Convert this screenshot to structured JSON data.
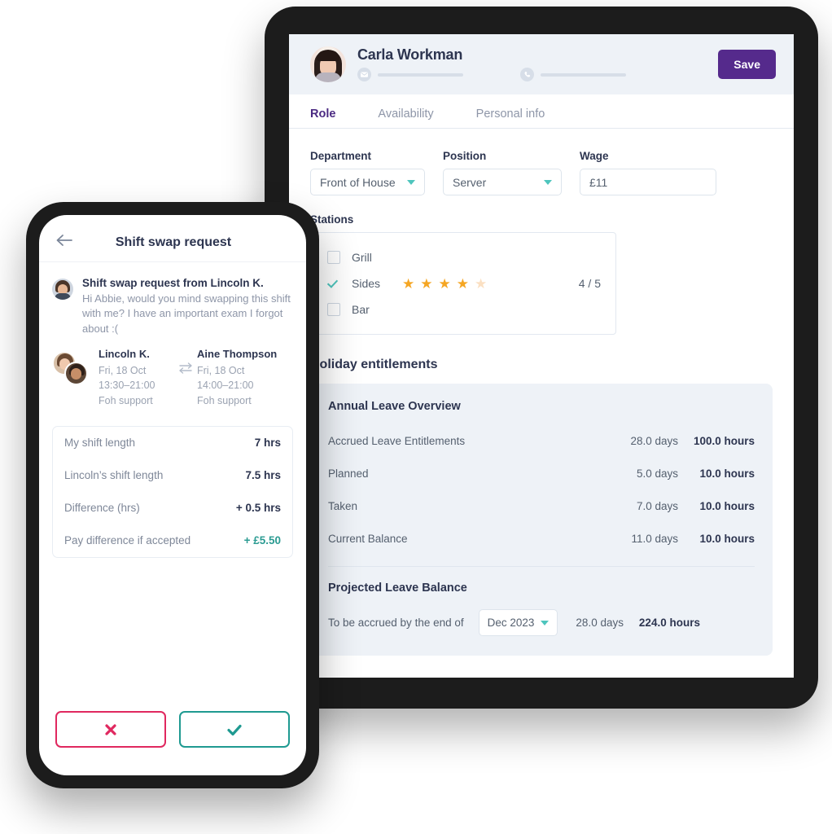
{
  "desktop": {
    "header": {
      "name": "Carla Workman",
      "avatar_icon": "user-avatar",
      "email_icon": "envelope-icon",
      "phone_icon": "phone-icon",
      "save_label": "Save",
      "save_color": "#552a8c",
      "background": "#eef2f7"
    },
    "tabs": [
      {
        "label": "Role",
        "active": true
      },
      {
        "label": "Availability",
        "active": false
      },
      {
        "label": "Personal info",
        "active": false
      }
    ],
    "fields": {
      "department": {
        "label": "Department",
        "value": "Front of House"
      },
      "position": {
        "label": "Position",
        "value": "Server"
      },
      "wage": {
        "label": "Wage",
        "value": "£11"
      }
    },
    "stations": {
      "label": "Stations",
      "items": [
        {
          "name": "Grill",
          "checked": false,
          "rating": null,
          "score": ""
        },
        {
          "name": "Sides",
          "checked": true,
          "rating": 4,
          "max": 5,
          "score": "4 / 5"
        },
        {
          "name": "Bar",
          "checked": false,
          "rating": null,
          "score": ""
        }
      ]
    },
    "holiday": {
      "title": "Holiday entitlements",
      "overview_title": "Annual Leave Overview",
      "rows": [
        {
          "label": "Accrued Leave Entitlements",
          "days": "28.0 days",
          "hours": "100.0 hours"
        },
        {
          "label": "Planned",
          "days": "5.0 days",
          "hours": "10.0 hours"
        },
        {
          "label": "Taken",
          "days": "7.0 days",
          "hours": "10.0 hours"
        },
        {
          "label": "Current Balance",
          "days": "11.0 days",
          "hours": "10.0 hours"
        }
      ],
      "projected_title": "Projected Leave Balance",
      "projected": {
        "label": "To be accrued by the end of",
        "month": "Dec 2023",
        "days": "28.0 days",
        "hours": "224.0 hours"
      }
    }
  },
  "phone": {
    "back_icon": "back-arrow-icon",
    "title": "Shift swap request",
    "message": {
      "title": "Shift swap request from Lincoln K.",
      "body": "Hi Abbie, would you mind swapping this shift with me? I have an important exam I forgot about :("
    },
    "swap": {
      "icon": "swap-arrows-icon",
      "from": {
        "name": "Lincoln K.",
        "date": "Fri, 18 Oct",
        "time": "13:30–21:00",
        "role": "Foh support"
      },
      "to": {
        "name": "Aine Thompson",
        "date": "Fri, 18 Oct",
        "time": "14:00–21:00",
        "role": "Foh support"
      }
    },
    "details": [
      {
        "label": "My shift length",
        "value": "7 hrs",
        "accent": false
      },
      {
        "label": "Lincoln’s shift length",
        "value": "7.5 hrs",
        "accent": false
      },
      {
        "label": "Difference (hrs)",
        "value": "+ 0.5 hrs",
        "accent": false
      },
      {
        "label": "Pay difference if accepted",
        "value": "+ £5.50",
        "accent": true
      }
    ],
    "actions": {
      "reject_icon": "cross-icon",
      "reject_color": "#e0285f",
      "accept_icon": "check-icon",
      "accept_color": "#1f9a91"
    }
  }
}
